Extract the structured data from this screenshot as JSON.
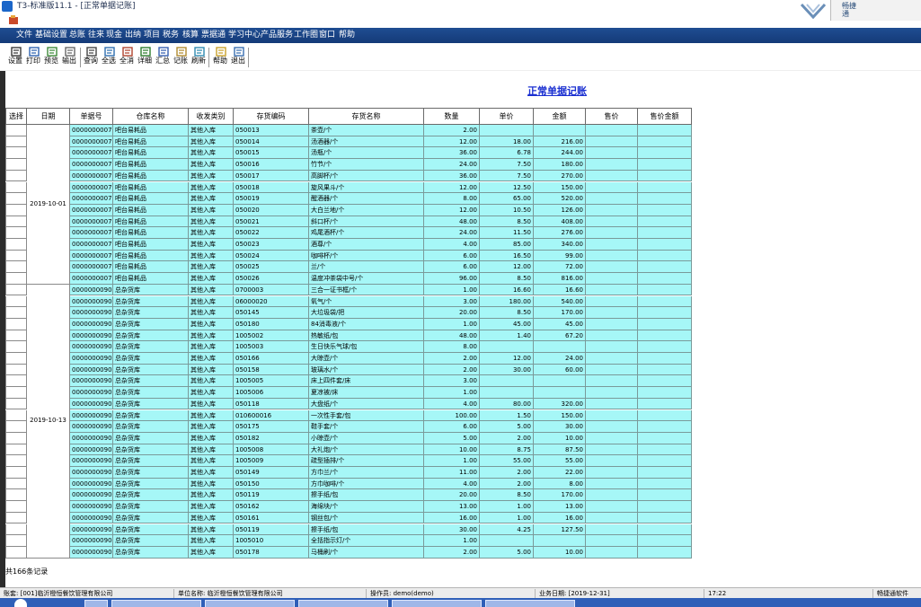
{
  "window": {
    "title": "T3-标准版11.1 - [正常单据记账]",
    "brand": "畅捷通"
  },
  "menu": [
    "文件",
    "基础设置",
    "总账",
    "往来",
    "现金",
    "出纳",
    "项目",
    "税务",
    "核算",
    "票据通",
    "学习中心",
    "产品服务",
    "工作圈",
    "窗口",
    "帮助"
  ],
  "toolbar": [
    "设置",
    "打印",
    "预览",
    "输出",
    "查询",
    "全选",
    "全消",
    "详细",
    "汇总",
    "记账",
    "刷新",
    "帮助",
    "退出"
  ],
  "report_title": "正常单据记账",
  "columns": [
    "选择",
    "日期",
    "单据号",
    "仓库名称",
    "收发类别",
    "存货编码",
    "存货名称",
    "数量",
    "单价",
    "金额",
    "售价",
    "售价金额"
  ],
  "groups": [
    {
      "date": "2019-10-01",
      "rows": [
        [
          "0000000007",
          "吧台易耗品",
          "其他入库",
          "050013",
          "茶壶/个",
          "2.00",
          "",
          ""
        ],
        [
          "0000000007",
          "吧台易耗品",
          "其他入库",
          "050014",
          "汤酒器/个",
          "12.00",
          "18.00",
          "216.00"
        ],
        [
          "0000000007",
          "吧台易耗品",
          "其他入库",
          "050015",
          "汤瓶/个",
          "36.00",
          "6.78",
          "244.00"
        ],
        [
          "0000000007",
          "吧台易耗品",
          "其他入库",
          "050016",
          "竹节/个",
          "24.00",
          "7.50",
          "180.00"
        ],
        [
          "0000000007",
          "吧台易耗品",
          "其他入库",
          "050017",
          "高脚杯/个",
          "36.00",
          "7.50",
          "270.00"
        ],
        [
          "0000000007",
          "吧台易耗品",
          "其他入库",
          "050018",
          "旋风果斗/个",
          "12.00",
          "12.50",
          "150.00"
        ],
        [
          "0000000007",
          "吧台易耗品",
          "其他入库",
          "050019",
          "醒酒器/个",
          "8.00",
          "65.00",
          "520.00"
        ],
        [
          "0000000007",
          "吧台易耗品",
          "其他入库",
          "050020",
          "大白兰地/个",
          "12.00",
          "10.50",
          "126.00"
        ],
        [
          "0000000007",
          "吧台易耗品",
          "其他入库",
          "050021",
          "斜口杯/个",
          "48.00",
          "8.50",
          "408.00"
        ],
        [
          "0000000007",
          "吧台易耗品",
          "其他入库",
          "050022",
          "鸡尾酒杯/个",
          "24.00",
          "11.50",
          "276.00"
        ],
        [
          "0000000007",
          "吧台易耗品",
          "其他入库",
          "050023",
          "酒尊/个",
          "4.00",
          "85.00",
          "340.00"
        ],
        [
          "0000000007",
          "吧台易耗品",
          "其他入库",
          "050024",
          "咖啡杯/个",
          "6.00",
          "16.50",
          "99.00"
        ],
        [
          "0000000007",
          "吧台易耗品",
          "其他入库",
          "050025",
          "兰/个",
          "6.00",
          "12.00",
          "72.00"
        ],
        [
          "0000000007",
          "吧台易耗品",
          "其他入库",
          "050026",
          "温度冲茶袋中号/个",
          "96.00",
          "8.50",
          "816.00"
        ]
      ]
    },
    {
      "date": "2019-10-13",
      "rows": [
        [
          "0000000090",
          "总杂货库",
          "其他入库",
          "0700003",
          "三合一证书框/个",
          "1.00",
          "16.60",
          "16.60"
        ],
        [
          "0000000090",
          "总杂货库",
          "其他入库",
          "06000020",
          "氧气/个",
          "3.00",
          "180.00",
          "540.00"
        ],
        [
          "0000000090",
          "总杂货库",
          "其他入库",
          "050145",
          "大垃圾袋/把",
          "20.00",
          "8.50",
          "170.00"
        ],
        [
          "0000000090",
          "总杂货库",
          "其他入库",
          "050180",
          "84消毒液/个",
          "1.00",
          "45.00",
          "45.00"
        ],
        [
          "0000000090",
          "总杂货库",
          "其他入库",
          "1005002",
          "热敏纸/包",
          "48.00",
          "1.40",
          "67.20"
        ],
        [
          "0000000090",
          "总杂货库",
          "其他入库",
          "1005003",
          "生日快乐气球/包",
          "8.00",
          "",
          ""
        ],
        [
          "0000000090",
          "总杂货库",
          "其他入库",
          "050166",
          "大晾壶/个",
          "2.00",
          "12.00",
          "24.00"
        ],
        [
          "0000000090",
          "总杂货库",
          "其他入库",
          "050158",
          "玻璃水/个",
          "2.00",
          "30.00",
          "60.00"
        ],
        [
          "0000000090",
          "总杂货库",
          "其他入库",
          "1005005",
          "床上四件套/床",
          "3.00",
          "",
          ""
        ],
        [
          "0000000090",
          "总杂货库",
          "其他入库",
          "1005006",
          "夏凉被/床",
          "1.00",
          "",
          ""
        ],
        [
          "0000000090",
          "总杂货库",
          "其他入库",
          "050118",
          "大盘纸/个",
          "4.00",
          "80.00",
          "320.00"
        ],
        [
          "0000000090",
          "总杂货库",
          "其他入库",
          "010600016",
          "一次性手套/包",
          "100.00",
          "1.50",
          "150.00"
        ],
        [
          "0000000090",
          "总杂货库",
          "其他入库",
          "050175",
          "鞋手套/个",
          "6.00",
          "5.00",
          "30.00"
        ],
        [
          "0000000090",
          "总杂货库",
          "其他入库",
          "050182",
          "小晾壶/个",
          "5.00",
          "2.00",
          "10.00"
        ],
        [
          "0000000090",
          "总杂货库",
          "其他入库",
          "1005008",
          "大礼炮/个",
          "10.00",
          "8.75",
          "87.50"
        ],
        [
          "0000000090",
          "总杂货库",
          "其他入库",
          "1005009",
          "疏型插排/个",
          "1.00",
          "55.00",
          "55.00"
        ],
        [
          "0000000090",
          "总杂货库",
          "其他入库",
          "050149",
          "方巾兰/个",
          "11.00",
          "2.00",
          "22.00"
        ],
        [
          "0000000090",
          "总杂货库",
          "其他入库",
          "050150",
          "方巾咖啡/个",
          "4.00",
          "2.00",
          "8.00"
        ],
        [
          "0000000090",
          "总杂货库",
          "其他入库",
          "050119",
          "擦手纸/包",
          "20.00",
          "8.50",
          "170.00"
        ],
        [
          "0000000090",
          "总杂货库",
          "其他入库",
          "050162",
          "海绵块/个",
          "13.00",
          "1.00",
          "13.00"
        ],
        [
          "0000000090",
          "总杂货库",
          "其他入库",
          "050161",
          "钢丝包/个",
          "16.00",
          "1.00",
          "16.00"
        ],
        [
          "0000000090",
          "总杂货库",
          "其他入库",
          "050119",
          "擦手纸/包",
          "30.00",
          "4.25",
          "127.50"
        ],
        [
          "0000000090",
          "总杂货库",
          "其他入库",
          "1005010",
          "全括指示灯/个",
          "1.00",
          "",
          ""
        ],
        [
          "0000000090",
          "总杂货库",
          "其他入库",
          "050178",
          "马桶刷/个",
          "2.00",
          "5.00",
          "10.00"
        ]
      ]
    }
  ],
  "record_count": "共166条记录",
  "status": {
    "account": "账套: [001]临沂橙恒餐饮管理有限公司",
    "unit": "单位名称: 临沂橙恒餐饮管理有限公司",
    "operator": "操作员: demo(demo)",
    "business_date": "业务日期: [2019-12-31]",
    "time": "17:22",
    "vendor": "畅捷通软件"
  },
  "colors": {
    "menubar": "#1f4d92",
    "cell_fill": "#a6f7f7",
    "title": "#1a2fd1",
    "taskbar": "#2f5fb8"
  },
  "icons": [
    "app-icon",
    "settings-icon",
    "print-icon",
    "preview-icon",
    "export-icon",
    "query-icon",
    "select-all-icon",
    "deselect-icon",
    "detail-icon",
    "summary-icon",
    "post-icon",
    "refresh-icon",
    "help-icon",
    "exit-icon"
  ]
}
